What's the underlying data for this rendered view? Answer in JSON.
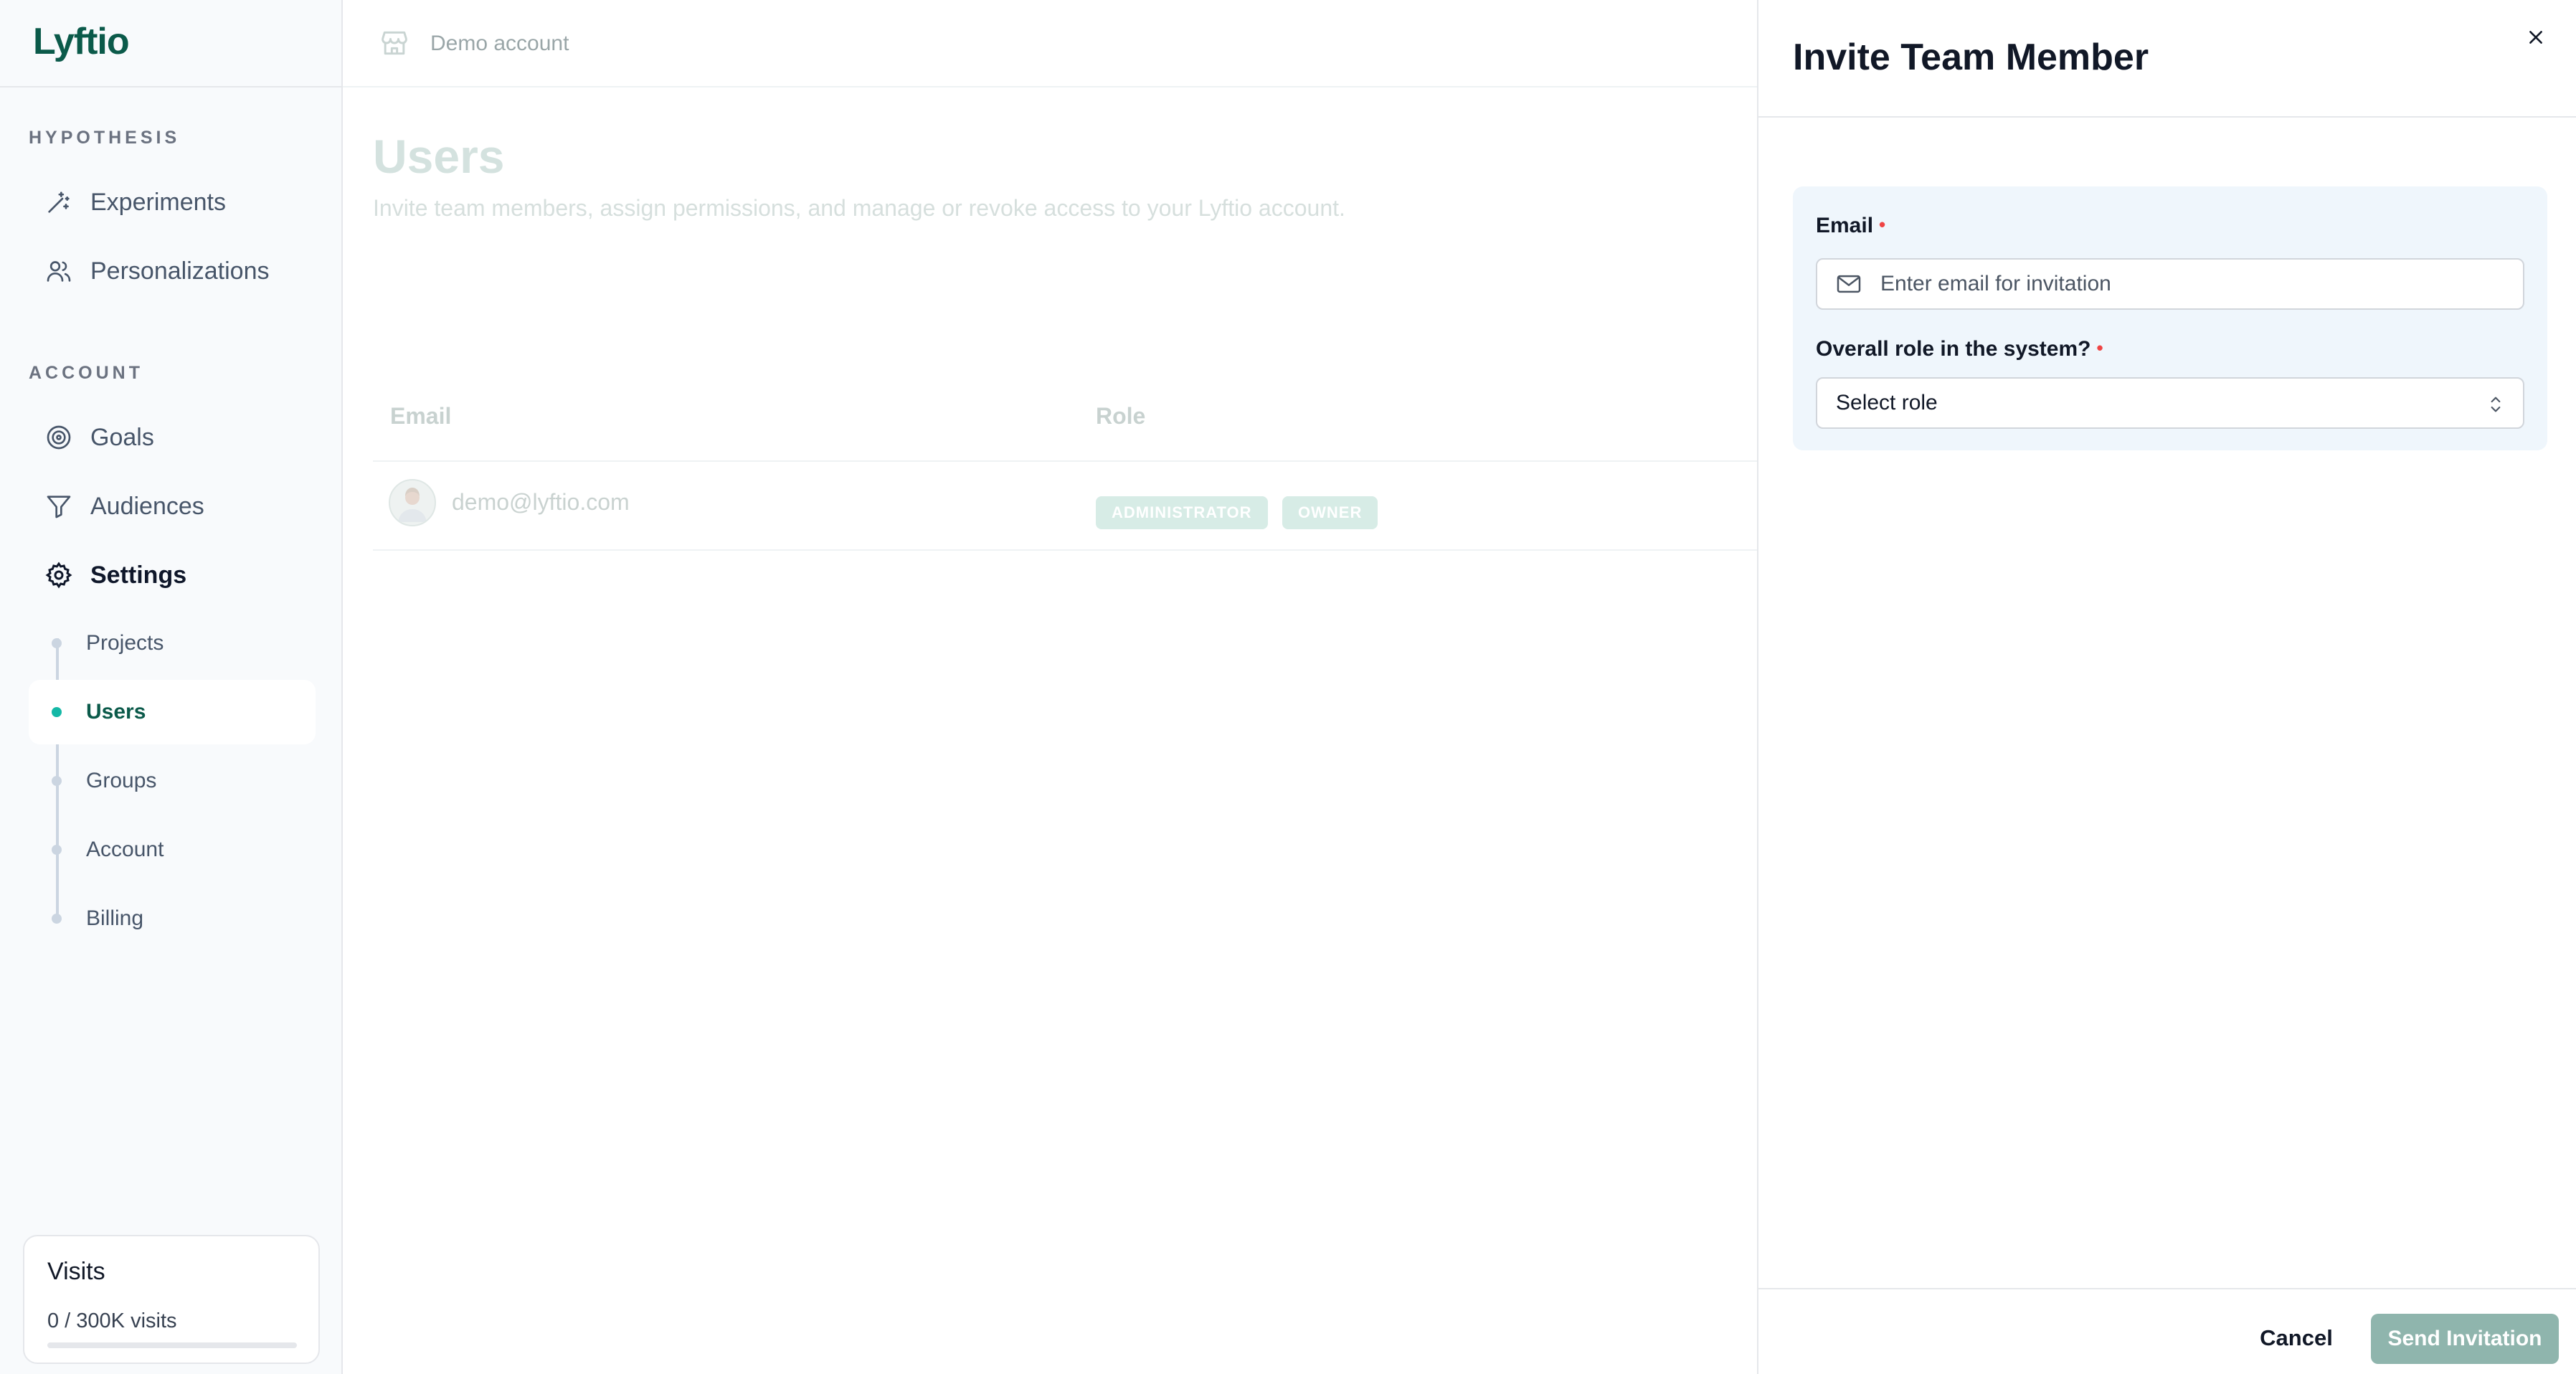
{
  "brand": {
    "name": "Lyftio",
    "color": "#0b5a4a"
  },
  "sidebar": {
    "sections": [
      {
        "label": "HYPOTHESIS"
      },
      {
        "label": "ACCOUNT"
      }
    ],
    "items": [
      {
        "label": "Experiments",
        "icon": "magic-wand-icon"
      },
      {
        "label": "Personalizations",
        "icon": "users-icon"
      },
      {
        "label": "Goals",
        "icon": "target-icon"
      },
      {
        "label": "Audiences",
        "icon": "filter-icon"
      },
      {
        "label": "Settings",
        "icon": "gear-icon",
        "active": true
      }
    ],
    "settings_subitems": [
      {
        "label": "Projects"
      },
      {
        "label": "Users",
        "active": true
      },
      {
        "label": "Groups"
      },
      {
        "label": "Account"
      },
      {
        "label": "Billing"
      }
    ],
    "visits": {
      "title": "Visits",
      "text": "0 / 300K visits",
      "progress": 0
    }
  },
  "header": {
    "account_name": "Demo account"
  },
  "main": {
    "title": "Users",
    "subtitle": "Invite team members, assign permissions, and manage or revoke access to your Lyftio account.",
    "table": {
      "columns": [
        "Email",
        "Role"
      ],
      "rows": [
        {
          "email": "demo@lyftio.com",
          "roles": [
            "ADMINISTRATOR",
            "OWNER"
          ]
        }
      ]
    }
  },
  "drawer": {
    "title": "Invite Team Member",
    "email_label": "Email",
    "email_placeholder": "Enter email for invitation",
    "email_value": "",
    "role_label": "Overall role in the system?",
    "role_value": "Select role",
    "required_marker": "•",
    "cancel_label": "Cancel",
    "send_label": "Send Invitation"
  },
  "colors": {
    "accent": "#14b8a6",
    "send_button": "#8fb5ad",
    "required": "#ef4444"
  }
}
